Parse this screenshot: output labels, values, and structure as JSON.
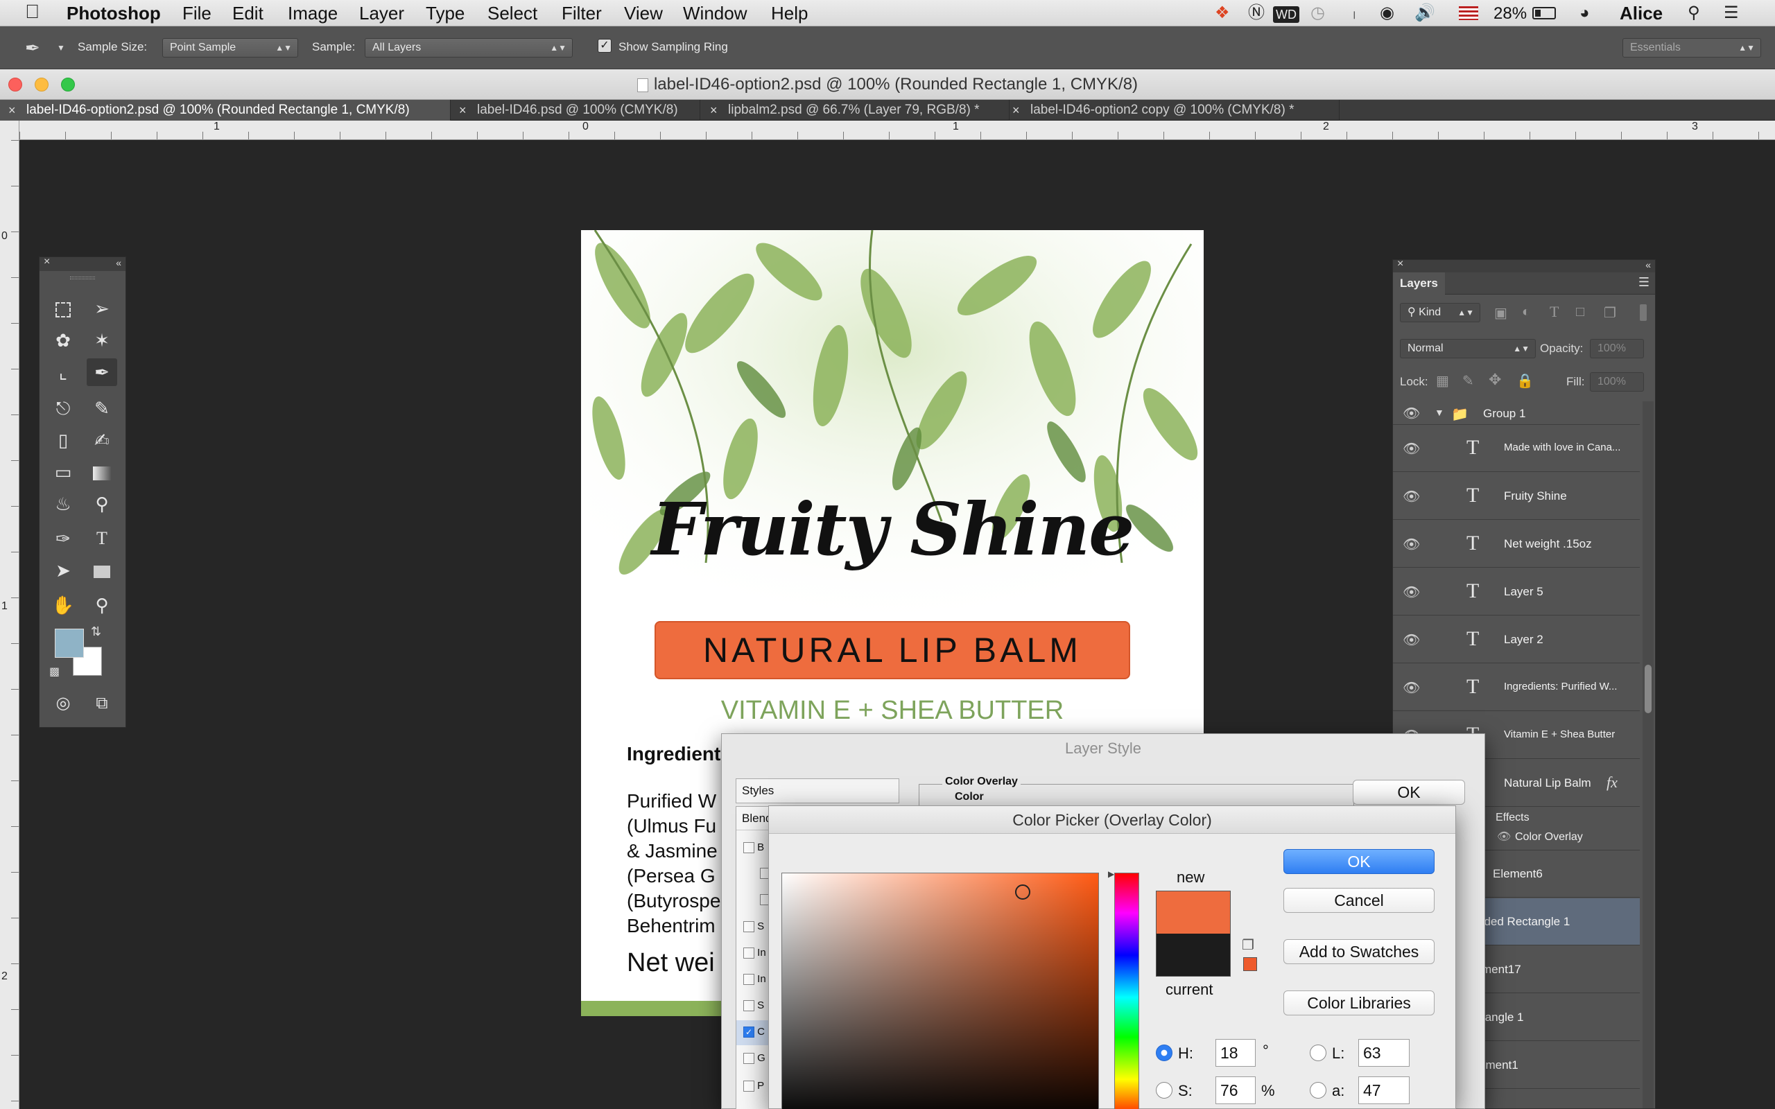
{
  "menubar": {
    "app": "Photoshop",
    "items": [
      "File",
      "Edit",
      "Image",
      "Layer",
      "Type",
      "Select",
      "Filter",
      "View",
      "Window",
      "Help"
    ],
    "battery": "28%",
    "user": "Alice"
  },
  "options": {
    "sample_size_label": "Sample Size:",
    "sample_size_value": "Point Sample",
    "sample_label": "Sample:",
    "sample_value": "All Layers",
    "show_ring_label": "Show Sampling Ring",
    "workspace": "Essentials"
  },
  "window": {
    "title": "label-ID46-option2.psd @ 100% (Rounded Rectangle 1, CMYK/8)"
  },
  "tabs": [
    "label-ID46-option2.psd @ 100% (Rounded Rectangle 1, CMYK/8)",
    "label-ID46.psd @ 100% (CMYK/8)",
    "lipbalm2.psd @ 66.7% (Layer 79, RGB/8) *",
    "label-ID46-option2 copy @ 100% (CMYK/8) *"
  ],
  "rulers": {
    "h": [
      "1",
      "0",
      "1",
      "2",
      "3"
    ],
    "v": [
      "0",
      "1",
      "2"
    ]
  },
  "document": {
    "title": "Fruity Shine",
    "banner": "NATURAL LIP BALM",
    "subtitle": "VITAMIN E + SHEA BUTTER",
    "ingredients_heading": "Ingredient",
    "ingredients_lines": [
      "Purified W",
      "(Ulmus Fu",
      "&  Jasmine",
      "(Persea G",
      "(Butyrospe",
      "Behentrim"
    ],
    "net_weight": "Net wei",
    "colors": {
      "banner": "#ee6c3e",
      "subtitle": "#7ea45c",
      "leaf": "#8cb35a"
    }
  },
  "layers_panel": {
    "tab": "Layers",
    "filter_kind": "Kind",
    "blend_mode": "Normal",
    "opacity_label": "Opacity:",
    "opacity_value": "100%",
    "lock_label": "Lock:",
    "fill_label": "Fill:",
    "fill_value": "100%",
    "group": "Group 1",
    "type_layers": [
      "Made with love in Cana...",
      "Fruity Shine",
      "Net weight .15oz",
      "Layer 5",
      "Layer 2",
      "Ingredients:  Purified W...",
      "Vitamin E + Shea Butter"
    ],
    "natural_lip_balm": "Natural Lip Balm",
    "fx": "fx",
    "effects": "Effects",
    "color_overlay": "Color Overlay",
    "more_layers": [
      "Element6",
      "nded Rectangle 1",
      "ment17",
      "tangle 1",
      "ement1"
    ]
  },
  "layer_style": {
    "title": "Layer Style",
    "styles_header": "Styles",
    "blend_partial": "Blend",
    "section": "Color Overlay",
    "subsection": "Color",
    "ok": "OK",
    "list_initials": [
      "B",
      "",
      "",
      "S",
      "In",
      "In",
      "S",
      "C",
      "G",
      "P"
    ]
  },
  "color_picker": {
    "title": "Color Picker (Overlay Color)",
    "ok": "OK",
    "cancel": "Cancel",
    "add_swatches": "Add to Swatches",
    "libraries": "Color Libraries",
    "new_label": "new",
    "current_label": "current",
    "new_color": "#ee6c3e",
    "current_color": "#1c1c1c",
    "h_label": "H:",
    "h_value": "18",
    "h_unit": "°",
    "s_label": "S:",
    "s_value": "76",
    "s_unit": "%",
    "l_label": "L:",
    "l_value": "63",
    "a_label": "a:",
    "a_value": "47"
  },
  "swatches": {
    "foreground": "#8fb3c6",
    "background": "#ffffff"
  }
}
